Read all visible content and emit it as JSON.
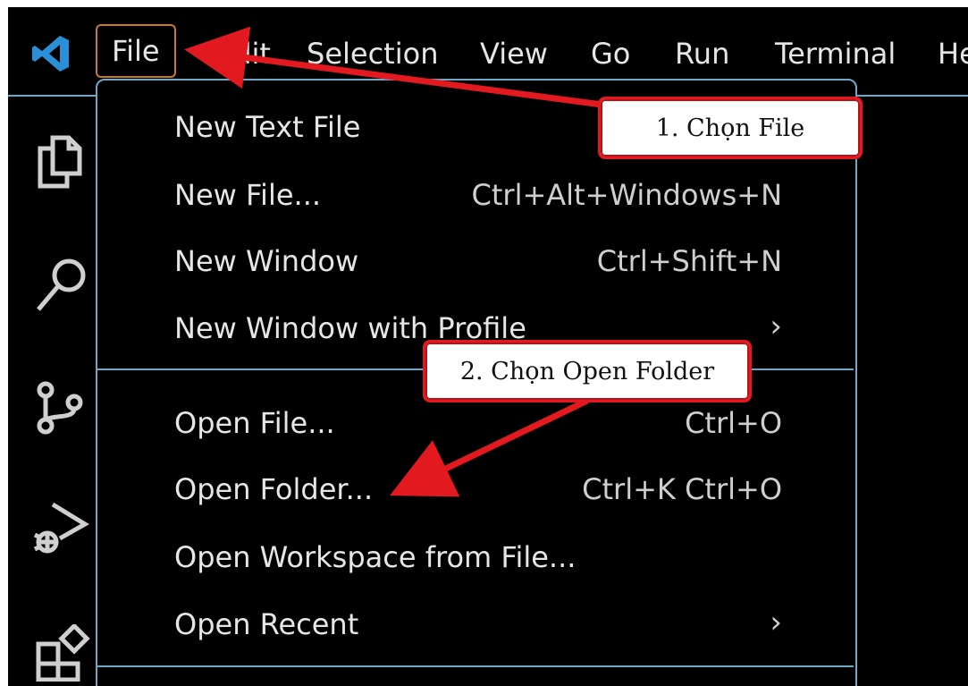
{
  "menubar": {
    "items": [
      "File",
      "Edit",
      "Selection",
      "View",
      "Go",
      "Run",
      "Terminal",
      "He"
    ]
  },
  "activity_bar": {
    "icons": [
      "explorer-icon",
      "search-icon",
      "source-control-icon",
      "run-debug-icon",
      "extensions-icon"
    ]
  },
  "file_menu": {
    "items": [
      {
        "label": "New Text File",
        "shortcut": ""
      },
      {
        "label": "New File...",
        "shortcut": "Ctrl+Alt+Windows+N"
      },
      {
        "label": "New Window",
        "shortcut": "Ctrl+Shift+N"
      },
      {
        "label": "New Window with Profile",
        "submenu": "›"
      },
      {
        "label": "Open File...",
        "shortcut": "Ctrl+O"
      },
      {
        "label": "Open Folder...",
        "shortcut": "Ctrl+K Ctrl+O"
      },
      {
        "label": "Open Workspace from File...",
        "shortcut": ""
      },
      {
        "label": "Open Recent",
        "submenu": "›"
      }
    ]
  },
  "annotations": {
    "step1": "1. Chọn File",
    "step2": "2. Chọn Open Folder"
  },
  "colors": {
    "background": "#000000",
    "menu_border": "#6fa8c7",
    "annotation_red": "#e2191f",
    "file_highlight": "#c9782c",
    "vscode_blue": "#2a8fd6"
  }
}
